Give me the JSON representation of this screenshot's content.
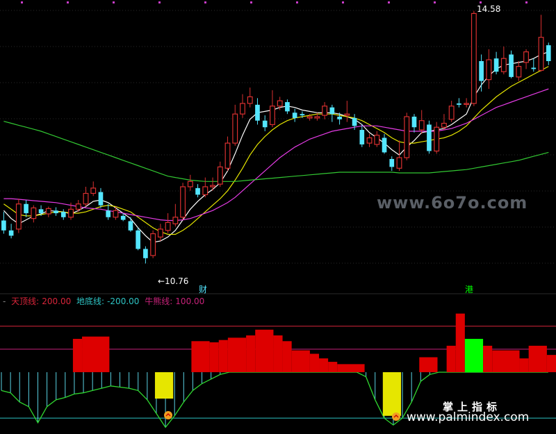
{
  "colors": {
    "background": "#000000",
    "up": "#d93030",
    "down": "#54e6ff",
    "ma_white": "#ffffff",
    "ma_yellow": "#e6e600",
    "ma_magenta": "#e63ce6",
    "ma_green": "#32c832",
    "top_line": "#d9253a",
    "bottom_line": "#2ec4c4",
    "bull_line": "#c8227a",
    "bar_red": "#dd0000",
    "bar_yellow": "#e6e600",
    "bar_green": "#00ff00",
    "osc_cyan": "#5ad4e6"
  },
  "annotations": {
    "high_label": "14.58",
    "low_label": "←10.76",
    "marker_cai": "财",
    "marker_gang": "港"
  },
  "legend": {
    "top_name": "天顶线:",
    "top_value": "200.00",
    "bottom_name": "地底线:",
    "bottom_value": "-200.00",
    "bull_name": "牛熊线:",
    "bull_value": "100.00"
  },
  "watermarks": {
    "site": "www.6o7o.com",
    "cn": "掌上指标",
    "url": "www.palmindex.com"
  },
  "chart_data": [
    {
      "type": "candlestick",
      "title": "",
      "high_marker": 14.58,
      "low_marker": 10.76,
      "ylim": [
        10.5,
        14.7
      ],
      "candles": [
        [
          11.45,
          11.3,
          11.58,
          11.25
        ],
        [
          11.3,
          11.22,
          11.4,
          11.18
        ],
        [
          11.32,
          11.7,
          11.78,
          11.26
        ],
        [
          11.7,
          11.56,
          11.76,
          11.5
        ],
        [
          11.48,
          11.64,
          11.68,
          11.42
        ],
        [
          11.62,
          11.56,
          11.68,
          11.52
        ],
        [
          11.55,
          11.63,
          11.66,
          11.5
        ],
        [
          11.6,
          11.56,
          11.65,
          11.52
        ],
        [
          11.58,
          11.5,
          11.62,
          11.46
        ],
        [
          11.5,
          11.62,
          11.72,
          11.46
        ],
        [
          11.62,
          11.7,
          11.76,
          11.58
        ],
        [
          11.7,
          11.86,
          11.96,
          11.66
        ],
        [
          11.86,
          11.94,
          12.04,
          11.82
        ],
        [
          11.88,
          11.68,
          11.94,
          11.64
        ],
        [
          11.6,
          11.5,
          11.7,
          11.46
        ],
        [
          11.5,
          11.6,
          11.66,
          11.46
        ],
        [
          11.52,
          11.46,
          11.56,
          11.44
        ],
        [
          11.44,
          11.3,
          11.5,
          11.28
        ],
        [
          11.3,
          11.02,
          11.34,
          11.0
        ],
        [
          11.02,
          10.88,
          11.06,
          10.8
        ],
        [
          10.92,
          11.25,
          11.3,
          10.88
        ],
        [
          11.2,
          11.32,
          11.4,
          11.14
        ],
        [
          11.3,
          11.42,
          11.56,
          11.26
        ],
        [
          11.4,
          11.5,
          11.7,
          11.36
        ],
        [
          11.5,
          11.96,
          12.02,
          11.46
        ],
        [
          11.96,
          12.04,
          12.14,
          11.9
        ],
        [
          11.94,
          11.84,
          12.0,
          11.8
        ],
        [
          11.84,
          11.96,
          12.1,
          11.8
        ],
        [
          11.96,
          11.98,
          12.1,
          11.9
        ],
        [
          12.0,
          12.26,
          12.34,
          11.96
        ],
        [
          12.24,
          12.62,
          12.72,
          12.2
        ],
        [
          12.62,
          13.06,
          13.2,
          12.58
        ],
        [
          13.06,
          13.22,
          13.36,
          13.0
        ],
        [
          13.22,
          13.32,
          13.46,
          13.16
        ],
        [
          13.2,
          12.96,
          13.3,
          12.9
        ],
        [
          12.96,
          12.86,
          13.04,
          12.8
        ],
        [
          12.9,
          13.18,
          13.42,
          12.86
        ],
        [
          13.18,
          13.26,
          13.32,
          13.12
        ],
        [
          13.24,
          13.1,
          13.28,
          13.06
        ],
        [
          13.08,
          13.0,
          13.14,
          12.94
        ],
        [
          13.06,
          13.04,
          13.1,
          13.0
        ],
        [
          13.0,
          13.02,
          13.06,
          12.96
        ],
        [
          13.0,
          13.02,
          13.08,
          12.96
        ],
        [
          13.04,
          13.18,
          13.24,
          12.98
        ],
        [
          13.16,
          13.06,
          13.2,
          12.94
        ],
        [
          13.02,
          12.98,
          13.08,
          12.9
        ],
        [
          13.04,
          13.06,
          13.26,
          12.94
        ],
        [
          13.0,
          12.88,
          13.06,
          12.82
        ],
        [
          12.82,
          12.6,
          12.9,
          12.56
        ],
        [
          12.62,
          12.7,
          12.76,
          12.56
        ],
        [
          12.6,
          12.74,
          12.8,
          12.56
        ],
        [
          12.7,
          12.48,
          12.76,
          12.46
        ],
        [
          12.38,
          12.26,
          12.42,
          12.2
        ],
        [
          12.24,
          12.4,
          12.66,
          12.2
        ],
        [
          12.4,
          13.02,
          13.08,
          12.36
        ],
        [
          13.02,
          12.86,
          13.06,
          12.78
        ],
        [
          12.82,
          12.96,
          13.12,
          12.76
        ],
        [
          12.9,
          12.5,
          12.96,
          12.46
        ],
        [
          12.5,
          12.86,
          12.94,
          12.46
        ],
        [
          12.86,
          12.92,
          13.06,
          12.82
        ],
        [
          12.98,
          13.18,
          13.26,
          12.94
        ],
        [
          13.22,
          13.2,
          13.3,
          13.16
        ],
        [
          13.22,
          13.22,
          13.3,
          13.16
        ],
        [
          13.22,
          14.58,
          14.62,
          13.18
        ],
        [
          13.86,
          13.56,
          13.96,
          13.4
        ],
        [
          13.58,
          13.88,
          14.04,
          13.44
        ],
        [
          13.9,
          13.7,
          14.0,
          13.66
        ],
        [
          13.7,
          13.9,
          14.08,
          13.66
        ],
        [
          13.96,
          13.62,
          14.02,
          13.6
        ],
        [
          13.62,
          13.78,
          13.86,
          13.56
        ],
        [
          13.84,
          14.0,
          14.04,
          13.74
        ],
        [
          13.76,
          13.74,
          13.9,
          13.7
        ],
        [
          13.72,
          14.22,
          14.56,
          13.7
        ],
        [
          14.1,
          13.86,
          14.14,
          13.8
        ]
      ],
      "ma_series": [
        {
          "color_key": "ma_white",
          "values": [
            11.6,
            11.48,
            11.4,
            11.46,
            11.52,
            11.55,
            11.6,
            11.59,
            11.58,
            11.55,
            11.6,
            11.66,
            11.74,
            11.76,
            11.72,
            11.64,
            11.56,
            11.48,
            11.34,
            11.22,
            11.12,
            11.14,
            11.2,
            11.3,
            11.46,
            11.62,
            11.74,
            11.84,
            11.92,
            12.02,
            12.2,
            12.46,
            12.74,
            12.98,
            13.08,
            13.1,
            13.12,
            13.16,
            13.18,
            13.16,
            13.12,
            13.1,
            13.08,
            13.08,
            13.08,
            13.06,
            13.02,
            12.98,
            12.9,
            12.78,
            12.7,
            12.62,
            12.52,
            12.44,
            12.56,
            12.66,
            12.78,
            12.8,
            12.82,
            12.84,
            12.9,
            12.98,
            13.06,
            13.32,
            13.5,
            13.64,
            13.74,
            13.8,
            13.82,
            13.84,
            13.86,
            13.9,
            13.96,
            14.0
          ]
        },
        {
          "color_key": "ma_yellow",
          "values": [
            11.7,
            11.62,
            11.54,
            11.52,
            11.52,
            11.54,
            11.56,
            11.58,
            11.58,
            11.56,
            11.56,
            11.58,
            11.62,
            11.66,
            11.68,
            11.66,
            11.62,
            11.58,
            11.5,
            11.42,
            11.34,
            11.28,
            11.24,
            11.24,
            11.3,
            11.38,
            11.48,
            11.58,
            11.68,
            11.78,
            11.9,
            12.06,
            12.24,
            12.44,
            12.6,
            12.72,
            12.82,
            12.9,
            12.96,
            13.0,
            13.02,
            13.04,
            13.06,
            13.06,
            13.06,
            13.04,
            13.02,
            13.0,
            12.96,
            12.9,
            12.84,
            12.78,
            12.7,
            12.64,
            12.62,
            12.62,
            12.64,
            12.66,
            12.68,
            12.7,
            12.74,
            12.8,
            12.88,
            13.0,
            13.12,
            13.22,
            13.32,
            13.4,
            13.48,
            13.54,
            13.6,
            13.66,
            13.72,
            13.78
          ]
        },
        {
          "color_key": "ma_magenta",
          "values": [
            11.78,
            11.78,
            11.77,
            11.76,
            11.75,
            11.74,
            11.73,
            11.72,
            11.7,
            11.68,
            11.66,
            11.64,
            11.63,
            11.62,
            11.6,
            11.58,
            11.56,
            11.54,
            11.52,
            11.5,
            11.48,
            11.46,
            11.45,
            11.45,
            11.46,
            11.48,
            11.52,
            11.56,
            11.6,
            11.66,
            11.72,
            11.8,
            11.9,
            12.0,
            12.1,
            12.2,
            12.3,
            12.4,
            12.48,
            12.56,
            12.62,
            12.68,
            12.72,
            12.76,
            12.8,
            12.82,
            12.84,
            12.86,
            12.88,
            12.88,
            12.88,
            12.86,
            12.84,
            12.82,
            12.8,
            12.8,
            12.8,
            12.8,
            12.8,
            12.82,
            12.84,
            12.88,
            12.92,
            12.98,
            13.04,
            13.1,
            13.16,
            13.2,
            13.24,
            13.28,
            13.32,
            13.36,
            13.4,
            13.44
          ]
        },
        {
          "color_key": "ma_green",
          "values": [
            12.95,
            12.92,
            12.89,
            12.86,
            12.83,
            12.8,
            12.76,
            12.72,
            12.68,
            12.64,
            12.6,
            12.56,
            12.52,
            12.48,
            12.44,
            12.4,
            12.36,
            12.32,
            12.28,
            12.24,
            12.2,
            12.16,
            12.12,
            12.1,
            12.08,
            12.06,
            12.05,
            12.04,
            12.04,
            12.04,
            12.04,
            12.04,
            12.05,
            12.06,
            12.07,
            12.08,
            12.09,
            12.1,
            12.11,
            12.12,
            12.13,
            12.14,
            12.15,
            12.16,
            12.17,
            12.18,
            12.18,
            12.18,
            12.18,
            12.18,
            12.18,
            12.18,
            12.18,
            12.17,
            12.17,
            12.17,
            12.17,
            12.17,
            12.18,
            12.19,
            12.2,
            12.21,
            12.22,
            12.24,
            12.26,
            12.28,
            12.3,
            12.32,
            12.34,
            12.36,
            12.39,
            12.42,
            12.45,
            12.48
          ]
        }
      ]
    },
    {
      "type": "bar",
      "title": "",
      "ylim": [
        -260,
        290
      ],
      "reference_lines": {
        "top": 200,
        "bottom": -200,
        "bull": 100
      },
      "bars": [
        {
          "from": 0,
          "to": 4,
          "value": 0,
          "color_key": "bar_red"
        },
        {
          "from": 8,
          "to": 9,
          "value": 145,
          "color_key": "bar_red"
        },
        {
          "from": 9,
          "to": 12,
          "value": 155,
          "color_key": "bar_red"
        },
        {
          "from": 17,
          "to": 19,
          "value": -115,
          "color_key": "bar_yellow"
        },
        {
          "from": 21,
          "to": 23,
          "value": 135,
          "color_key": "bar_red"
        },
        {
          "from": 23,
          "to": 24,
          "value": 130,
          "color_key": "bar_red"
        },
        {
          "from": 24,
          "to": 25,
          "value": 140,
          "color_key": "bar_red"
        },
        {
          "from": 25,
          "to": 27,
          "value": 150,
          "color_key": "bar_red"
        },
        {
          "from": 27,
          "to": 28,
          "value": 160,
          "color_key": "bar_red"
        },
        {
          "from": 28,
          "to": 30,
          "value": 185,
          "color_key": "bar_red"
        },
        {
          "from": 30,
          "to": 31,
          "value": 160,
          "color_key": "bar_red"
        },
        {
          "from": 31,
          "to": 32,
          "value": 135,
          "color_key": "bar_red"
        },
        {
          "from": 32,
          "to": 34,
          "value": 95,
          "color_key": "bar_red"
        },
        {
          "from": 34,
          "to": 35,
          "value": 80,
          "color_key": "bar_red"
        },
        {
          "from": 35,
          "to": 36,
          "value": 60,
          "color_key": "bar_red"
        },
        {
          "from": 36,
          "to": 37,
          "value": 45,
          "color_key": "bar_red"
        },
        {
          "from": 37,
          "to": 40,
          "value": 35,
          "color_key": "bar_red"
        },
        {
          "from": 42,
          "to": 44,
          "value": -190,
          "color_key": "bar_yellow"
        },
        {
          "from": 46,
          "to": 48,
          "value": 65,
          "color_key": "bar_red"
        },
        {
          "from": 49,
          "to": 50,
          "value": 115,
          "color_key": "bar_red"
        },
        {
          "from": 50,
          "to": 51,
          "value": 255,
          "color_key": "bar_red"
        },
        {
          "from": 51,
          "to": 53,
          "value": 145,
          "color_key": "bar_green"
        },
        {
          "from": 53,
          "to": 54,
          "value": 115,
          "color_key": "bar_red"
        },
        {
          "from": 54,
          "to": 57,
          "value": 95,
          "color_key": "bar_red"
        },
        {
          "from": 57,
          "to": 58,
          "value": 60,
          "color_key": "bar_red"
        },
        {
          "from": 58,
          "to": 60,
          "value": 115,
          "color_key": "bar_red"
        },
        {
          "from": 60,
          "to": 61,
          "value": 75,
          "color_key": "bar_red"
        }
      ],
      "oscillator": [
        -80,
        -90,
        -130,
        -150,
        -220,
        -150,
        -120,
        -110,
        -95,
        -90,
        -80,
        -70,
        -60,
        -65,
        -70,
        -80,
        -120,
        -180,
        -240,
        -190,
        -130,
        -80,
        -50,
        -30,
        -10,
        0,
        0,
        0,
        0,
        0,
        0,
        0,
        0,
        0,
        0,
        0,
        0,
        0,
        0,
        0,
        -20,
        -120,
        -200,
        -230,
        -200,
        -130,
        -40,
        -10,
        0,
        0,
        0,
        0,
        0,
        0,
        0,
        0,
        0,
        0,
        0,
        0,
        0
      ]
    }
  ]
}
